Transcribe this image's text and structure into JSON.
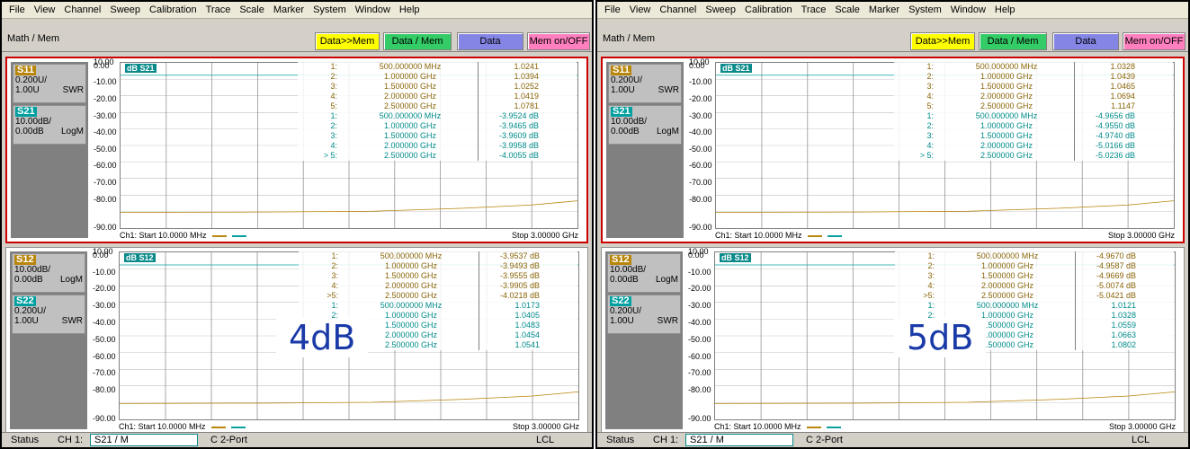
{
  "menu": [
    "File",
    "View",
    "Channel",
    "Sweep",
    "Calibration",
    "Trace",
    "Scale",
    "Marker",
    "System",
    "Window",
    "Help"
  ],
  "softkeys": {
    "title": "Math / Mem",
    "keys": [
      "Data>>Mem",
      "Data / Mem",
      "Data",
      "Mem on/OFF"
    ]
  },
  "y_ticks": [
    "10.00",
    "0.00",
    "-10.00",
    "-20.00",
    "-30.00",
    "-40.00",
    "-50.00",
    "-60.00",
    "-70.00",
    "-80.00",
    "-90.00"
  ],
  "colors": {
    "gold": "#b8860b",
    "teal": "#0aa0a0"
  },
  "windows": [
    {
      "top": {
        "trace1": {
          "name": "S11",
          "scale": "0.200U/",
          "ref": "1.00U",
          "fmt": "SWR",
          "color": "gold"
        },
        "trace2": {
          "name": "S21",
          "scale": "10.00dB/",
          "ref": "0.00dB",
          "fmt": "LogM",
          "color": "teal"
        },
        "tag": "dB S21",
        "readout": [
          {
            "n": "1:",
            "f": "500.000000 MHz",
            "v": "1.0241",
            "c": "gold"
          },
          {
            "n": "2:",
            "f": "1.000000 GHz",
            "v": "1.0394",
            "c": "gold"
          },
          {
            "n": "3:",
            "f": "1.500000 GHz",
            "v": "1.0252",
            "c": "gold"
          },
          {
            "n": "4:",
            "f": "2.000000 GHz",
            "v": "1.0419",
            "c": "gold"
          },
          {
            "n": "5:",
            "f": "2.500000 GHz",
            "v": "1.0781",
            "c": "gold"
          },
          {
            "n": "1:",
            "f": "500.000000 MHz",
            "v": "-3.9524 dB",
            "c": "teal"
          },
          {
            "n": "2:",
            "f": "1.000000 GHz",
            "v": "-3.9465 dB",
            "c": "teal"
          },
          {
            "n": "3:",
            "f": "1.500000 GHz",
            "v": "-3.9609 dB",
            "c": "teal"
          },
          {
            "n": "4:",
            "f": "2.000000 GHz",
            "v": "-3.9958 dB",
            "c": "teal"
          },
          {
            "n": "> 5:",
            "f": "2.500000 GHz",
            "v": "-4.0055 dB",
            "c": "teal"
          }
        ],
        "start": "Ch1: Start 10.0000 MHz",
        "stop": "Stop 3.00000 GHz"
      },
      "bottom": {
        "trace1": {
          "name": "S12",
          "scale": "10.00dB/",
          "ref": "0.00dB",
          "fmt": "LogM",
          "color": "gold"
        },
        "trace2": {
          "name": "S22",
          "scale": "0.200U/",
          "ref": "1.00U",
          "fmt": "SWR",
          "color": "teal"
        },
        "tag": "dB S12",
        "readout": [
          {
            "n": "1:",
            "f": "500.000000 MHz",
            "v": "-3.9537 dB",
            "c": "gold"
          },
          {
            "n": "2:",
            "f": "1.000000 GHz",
            "v": "-3.9493 dB",
            "c": "gold"
          },
          {
            "n": "3:",
            "f": "1.500000 GHz",
            "v": "-3.9555 dB",
            "c": "gold"
          },
          {
            "n": "4:",
            "f": "2.000000 GHz",
            "v": "-3.9905 dB",
            "c": "gold"
          },
          {
            "n": ">5:",
            "f": "2.500000 GHz",
            "v": "-4.0218 dB",
            "c": "gold"
          },
          {
            "n": "1:",
            "f": "500.000000 MHz",
            "v": "1.0173",
            "c": "teal"
          },
          {
            "n": "2:",
            "f": "1.000000 GHz",
            "v": "1.0405",
            "c": "teal"
          },
          {
            "n": "3:",
            "f": "1.500000 GHz",
            "v": "1.0483",
            "c": "teal"
          },
          {
            "n": "4:",
            "f": "2.000000 GHz",
            "v": "1.0454",
            "c": "teal"
          },
          {
            "n": "5:",
            "f": "2.500000 GHz",
            "v": "1.0541",
            "c": "teal"
          }
        ],
        "start": "Ch1: Start 10.0000 MHz",
        "stop": "Stop 3.00000 GHz"
      },
      "overlay": "4dB",
      "status": {
        "label": "Status",
        "ch": "CH 1:",
        "trace": "S21 / M",
        "port": "C  2-Port",
        "mode": "LCL"
      }
    },
    {
      "top": {
        "trace1": {
          "name": "S11",
          "scale": "0.200U/",
          "ref": "1.00U",
          "fmt": "SWR",
          "color": "gold"
        },
        "trace2": {
          "name": "S21",
          "scale": "10.00dB/",
          "ref": "0.00dB",
          "fmt": "LogM",
          "color": "teal"
        },
        "tag": "dB S21",
        "readout": [
          {
            "n": "1:",
            "f": "500.000000 MHz",
            "v": "1.0328",
            "c": "gold"
          },
          {
            "n": "2:",
            "f": "1.000000 GHz",
            "v": "1.0439",
            "c": "gold"
          },
          {
            "n": "3:",
            "f": "1.500000 GHz",
            "v": "1.0465",
            "c": "gold"
          },
          {
            "n": "4:",
            "f": "2.000000 GHz",
            "v": "1.0694",
            "c": "gold"
          },
          {
            "n": "5:",
            "f": "2.500000 GHz",
            "v": "1.1147",
            "c": "gold"
          },
          {
            "n": "1:",
            "f": "500.000000 MHz",
            "v": "-4.9656 dB",
            "c": "teal"
          },
          {
            "n": "2:",
            "f": "1.000000 GHz",
            "v": "-4.9550 dB",
            "c": "teal"
          },
          {
            "n": "3:",
            "f": "1.500000 GHz",
            "v": "-4.9740 dB",
            "c": "teal"
          },
          {
            "n": "4:",
            "f": "2.000000 GHz",
            "v": "-5.0166 dB",
            "c": "teal"
          },
          {
            "n": "> 5:",
            "f": "2.500000 GHz",
            "v": "-5.0236 dB",
            "c": "teal"
          }
        ],
        "start": "Ch1: Start 10.0000 MHz",
        "stop": "Stop 3.00000 GHz"
      },
      "bottom": {
        "trace1": {
          "name": "S12",
          "scale": "10.00dB/",
          "ref": "0.00dB",
          "fmt": "LogM",
          "color": "gold"
        },
        "trace2": {
          "name": "S22",
          "scale": "0.200U/",
          "ref": "1.00U",
          "fmt": "SWR",
          "color": "teal"
        },
        "tag": "dB S12",
        "readout": [
          {
            "n": "1:",
            "f": "500.000000 MHz",
            "v": "-4.9670 dB",
            "c": "gold"
          },
          {
            "n": "2:",
            "f": "1.000000 GHz",
            "v": "-4.9587 dB",
            "c": "gold"
          },
          {
            "n": "3:",
            "f": "1.500000 GHz",
            "v": "-4.9669 dB",
            "c": "gold"
          },
          {
            "n": "4:",
            "f": "2.000000 GHz",
            "v": "-5.0074 dB",
            "c": "gold"
          },
          {
            "n": ">5:",
            "f": "2.500000 GHz",
            "v": "-5.0421 dB",
            "c": "gold"
          },
          {
            "n": "1:",
            "f": "500.000000 MHz",
            "v": "1.0121",
            "c": "teal"
          },
          {
            "n": "2:",
            "f": "1.000000 GHz",
            "v": "1.0328",
            "c": "teal"
          },
          {
            "n": "3:",
            "f": "1.500000 GHz",
            "v": "1.0559",
            "c": "teal"
          },
          {
            "n": "4:",
            "f": "2.000000 GHz",
            "v": "1.0663",
            "c": "teal"
          },
          {
            "n": "5:",
            "f": "2.500000 GHz",
            "v": "1.0802",
            "c": "teal"
          }
        ],
        "start": "Ch1: Start 10.0000 MHz",
        "stop": "Stop 3.00000 GHz"
      },
      "overlay": "5dB",
      "status": {
        "label": "Status",
        "ch": "CH 1:",
        "trace": "S21 / M",
        "port": "C  2-Port",
        "mode": "LCL"
      }
    }
  ]
}
